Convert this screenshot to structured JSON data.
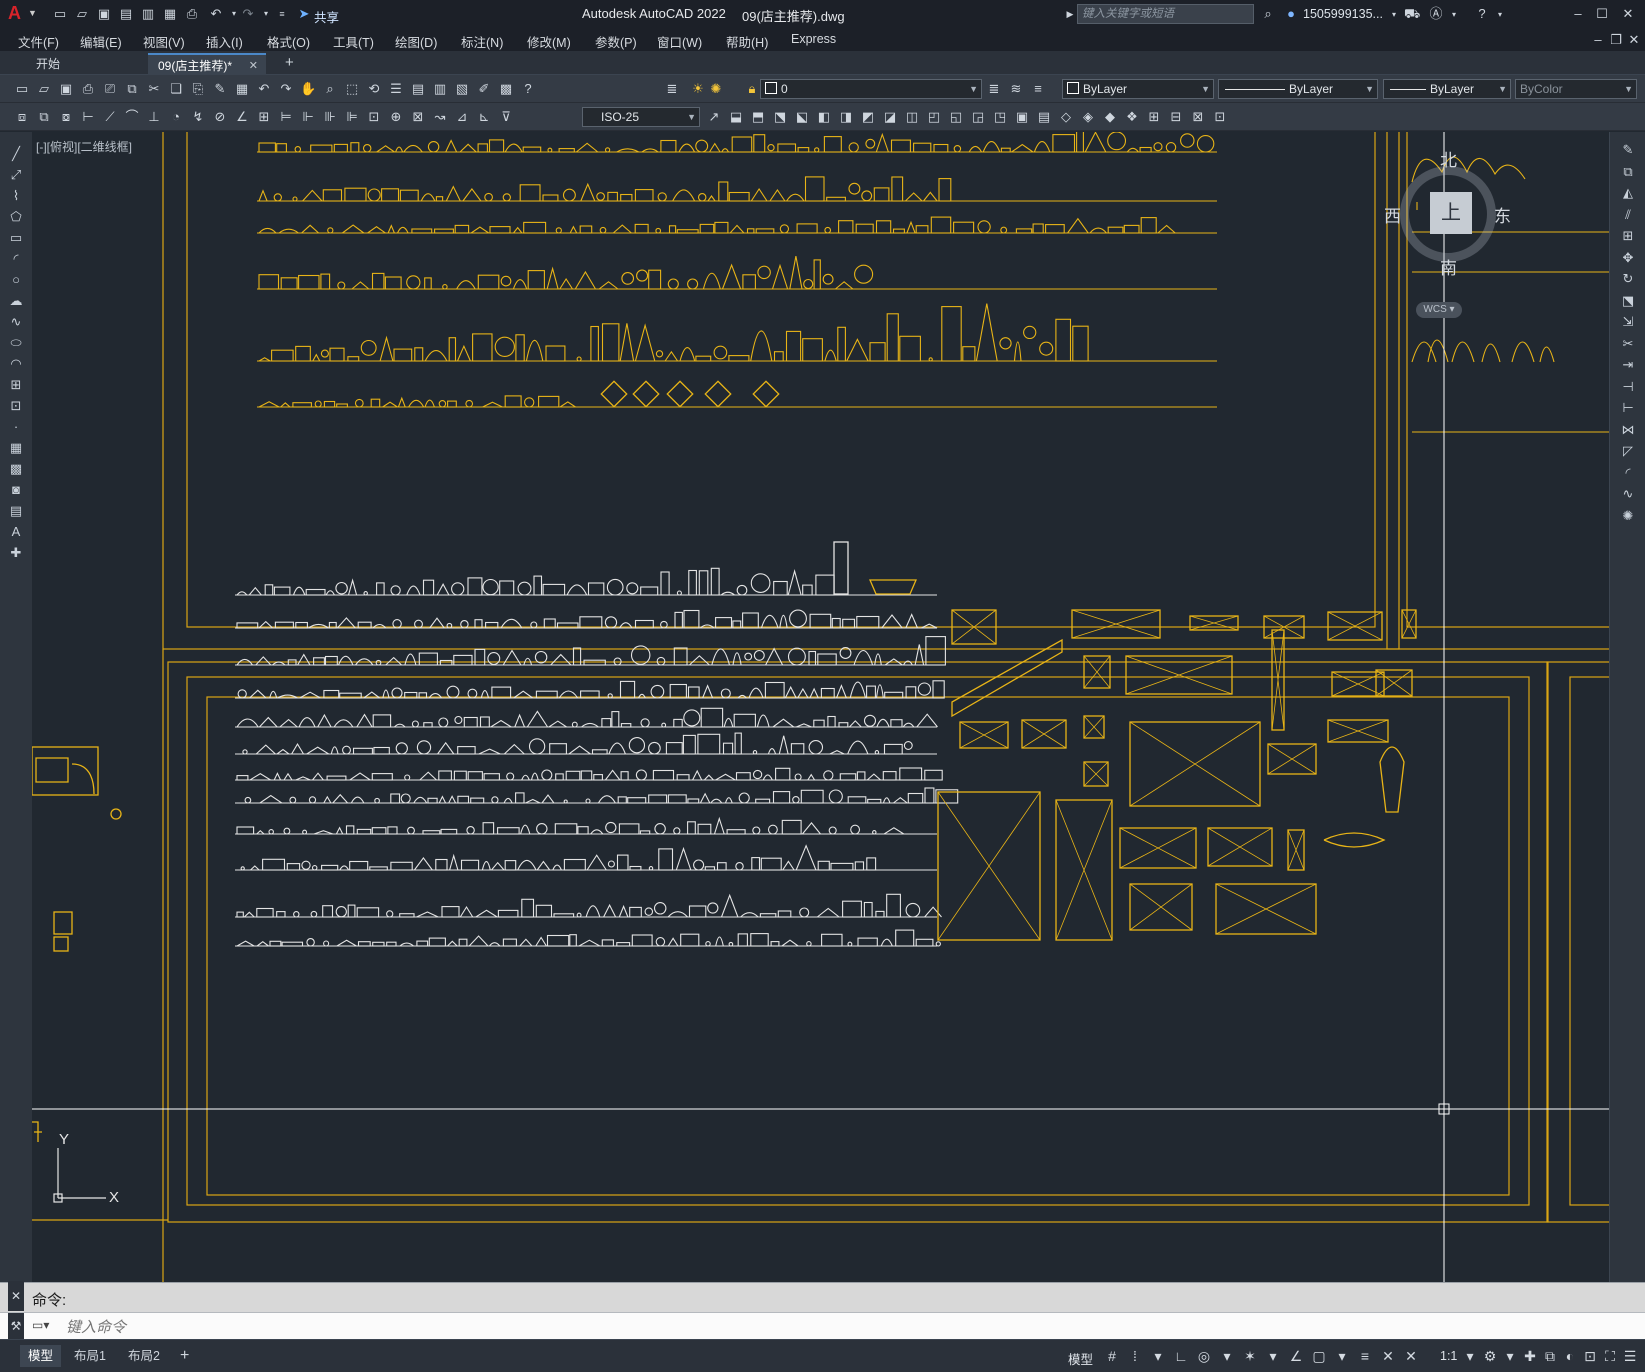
{
  "title": {
    "app": "Autodesk AutoCAD 2022",
    "file": "09(店主推荐).dwg",
    "share": "共享",
    "search_placeholder": "键入关键字或短语",
    "user": "1505999135...",
    "logo": "A"
  },
  "menu": [
    "文件(F)",
    "编辑(E)",
    "视图(V)",
    "插入(I)",
    "格式(O)",
    "工具(T)",
    "绘图(D)",
    "标注(N)",
    "修改(M)",
    "参数(P)",
    "窗口(W)",
    "帮助(H)",
    "Express"
  ],
  "tabs": {
    "start": "开始",
    "doc": "09(店主推荐)*",
    "close": "✕",
    "add": "+"
  },
  "toolbar": {
    "layer": "0",
    "color": "ByLayer",
    "linetype": "ByLayer",
    "lineweight": "ByLayer",
    "plotstyle": "ByColor",
    "dimstyle": "ISO-25"
  },
  "viewport": {
    "label": "[-][俯视][二维线框]",
    "viewcube": {
      "north": "北",
      "south": "南",
      "east": "东",
      "west": "西",
      "top": "上",
      "wcs": "WCS"
    },
    "ucs": {
      "x": "X",
      "y": "Y"
    }
  },
  "command": {
    "prompt": "命令:",
    "placeholder": "键入命令"
  },
  "status": {
    "tabs": [
      "模型",
      "布局1",
      "布局2"
    ],
    "add": "+",
    "model": "模型",
    "scale": "1:1"
  },
  "colors": {
    "accent": "#4b88c8",
    "drawing_yellow": "#e8b417",
    "drawing_white": "#e4e4e4",
    "canvas_bg": "#212830"
  }
}
